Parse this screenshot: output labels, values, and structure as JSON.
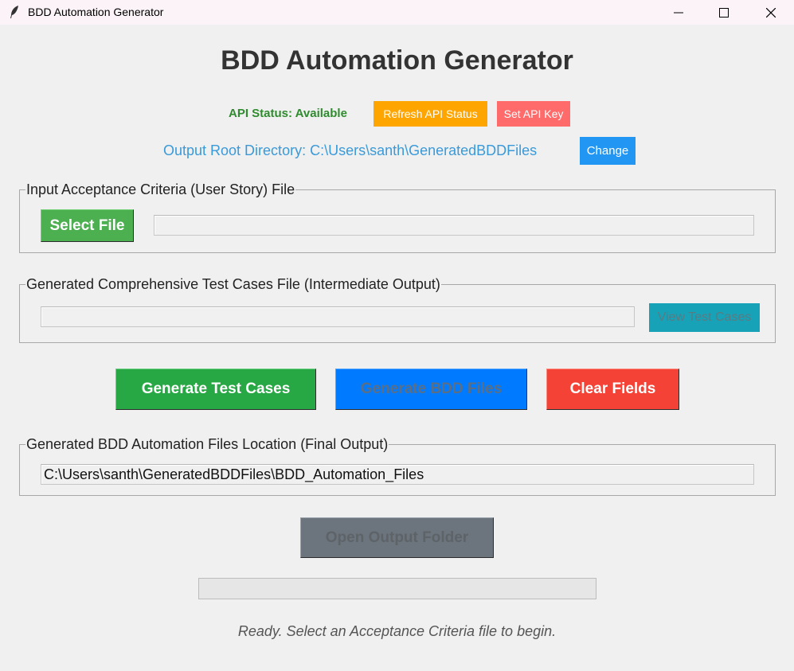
{
  "window": {
    "title": "BDD Automation Generator"
  },
  "header": {
    "title": "BDD Automation Generator"
  },
  "api": {
    "status_text": "API Status: Available",
    "refresh_label": "Refresh API Status",
    "set_key_label": "Set API Key"
  },
  "output_root": {
    "text": "Output Root Directory: C:\\Users\\santh\\GeneratedBDDFiles",
    "change_label": "Change"
  },
  "input_section": {
    "label": "Input Acceptance Criteria (User Story) File",
    "select_label": "Select File",
    "path_value": ""
  },
  "test_cases_section": {
    "label": "Generated Comprehensive Test Cases File (Intermediate Output)",
    "path_value": "",
    "view_label": "View Test Cases"
  },
  "actions": {
    "generate_test_cases_label": "Generate Test Cases",
    "generate_bdd_label": "Generate BDD Files",
    "clear_label": "Clear Fields"
  },
  "bdd_output_section": {
    "label": "Generated BDD Automation Files Location (Final Output)",
    "path_value": "C:\\Users\\santh\\GeneratedBDDFiles\\BDD_Automation_Files"
  },
  "open_output_label": "Open Output Folder",
  "progress": {
    "fraction": 0
  },
  "status": {
    "text": "Ready. Select an Acceptance Criteria file to begin."
  },
  "colors": {
    "api_available": "#2e8b2e",
    "refresh": "#ffa500",
    "set_key": "#ff6b6b",
    "change": "#2196f3",
    "select_file": "#4caf50",
    "view_test_cases": "#17a2b8",
    "generate_test_cases": "#28a745",
    "generate_bdd": "#007bff",
    "clear": "#f44336",
    "open_output": "#6c757d"
  },
  "icons": {
    "app": "feather-icon",
    "minimize": "minimize-icon",
    "maximize": "maximize-icon",
    "close": "close-icon"
  }
}
